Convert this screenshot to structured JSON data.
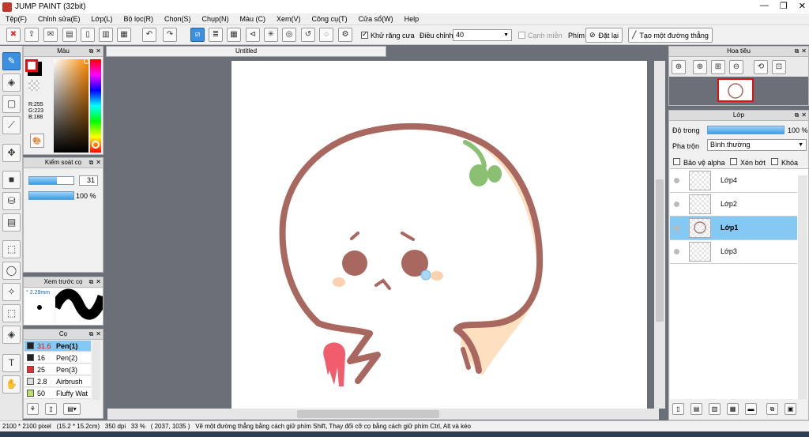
{
  "window": {
    "title": "JUMP PAINT (32bit)",
    "minimize": "—",
    "restore": "❐",
    "close": "✕"
  },
  "menu": [
    "Tệp(F)",
    "Chỉnh sửa(E)",
    "Lớp(L)",
    "Bộ lọc(R)",
    "Chọn(S)",
    "Chụp(N)",
    "Màu (C)",
    "Xem(V)",
    "Công cụ(T)",
    "Cửa sổ(W)",
    "Help"
  ],
  "toolbar": {
    "antialias_label": "Khử răng cưa",
    "adjust_label": "Điều chỉnh",
    "adjust_value": "40",
    "edge_label": "Cạnh miễn",
    "key_label": "Phím",
    "reset_label": "Đặt lại",
    "make_line_label": "Tạo một đường thẳng"
  },
  "doc_tab": "Untitled",
  "color_panel": {
    "title": "Màu",
    "r": "R:255",
    "g": "G:223",
    "b": "B:188",
    "fg_color": "#ff0000",
    "bg_color": "#000000"
  },
  "brush_control": {
    "title": "Kiểm soát cọ",
    "size_value": "31",
    "opacity_value": "100 %",
    "size_fraction": 0.31,
    "opacity_fraction": 1.0
  },
  "brush_preview": {
    "title": "Xem trước cọ",
    "size": "2.29mm"
  },
  "brushes": {
    "title": "Cọ",
    "items": [
      {
        "size": "31.6",
        "name": "Pen(1)",
        "color": "#222222",
        "selected": true
      },
      {
        "size": "16",
        "name": "Pen(2)",
        "color": "#222222",
        "selected": false
      },
      {
        "size": "25",
        "name": "Pen(3)",
        "color": "#e03030",
        "selected": false
      },
      {
        "size": "2.8",
        "name": "Airbrush",
        "color": "#dddddd",
        "selected": false
      },
      {
        "size": "50",
        "name": "Fluffy Wat",
        "color": "#b8e06a",
        "selected": false
      }
    ]
  },
  "navigator": {
    "title": "Hoa tiêu"
  },
  "layers_panel": {
    "title": "Lớp",
    "opacity_label": "Độ trong",
    "opacity_value": "100 %",
    "opacity_fraction": 1.0,
    "blend_label": "Pha trộn",
    "blend_value": "Bình thường",
    "protect_alpha": "Bảo vệ alpha",
    "clipping": "Xén bớt",
    "lock": "Khóa",
    "layers": [
      {
        "name": "Lớp4",
        "selected": false
      },
      {
        "name": "Lớp2",
        "selected": false
      },
      {
        "name": "Lớp1",
        "selected": true
      },
      {
        "name": "Lớp3",
        "selected": false
      }
    ]
  },
  "status": {
    "size": "2100 * 2100 pixel",
    "physical": "(15.2 * 15.2cm)",
    "dpi": "350 dpi",
    "zoom": "33 %",
    "coords": "( 2037, 1035 )",
    "hint": "Vẽ một đường thẳng bằng cách giữ phím Shift, Thay đổi cỡ cọ bằng cách giữ phím Ctrl, Alt và kéo"
  }
}
